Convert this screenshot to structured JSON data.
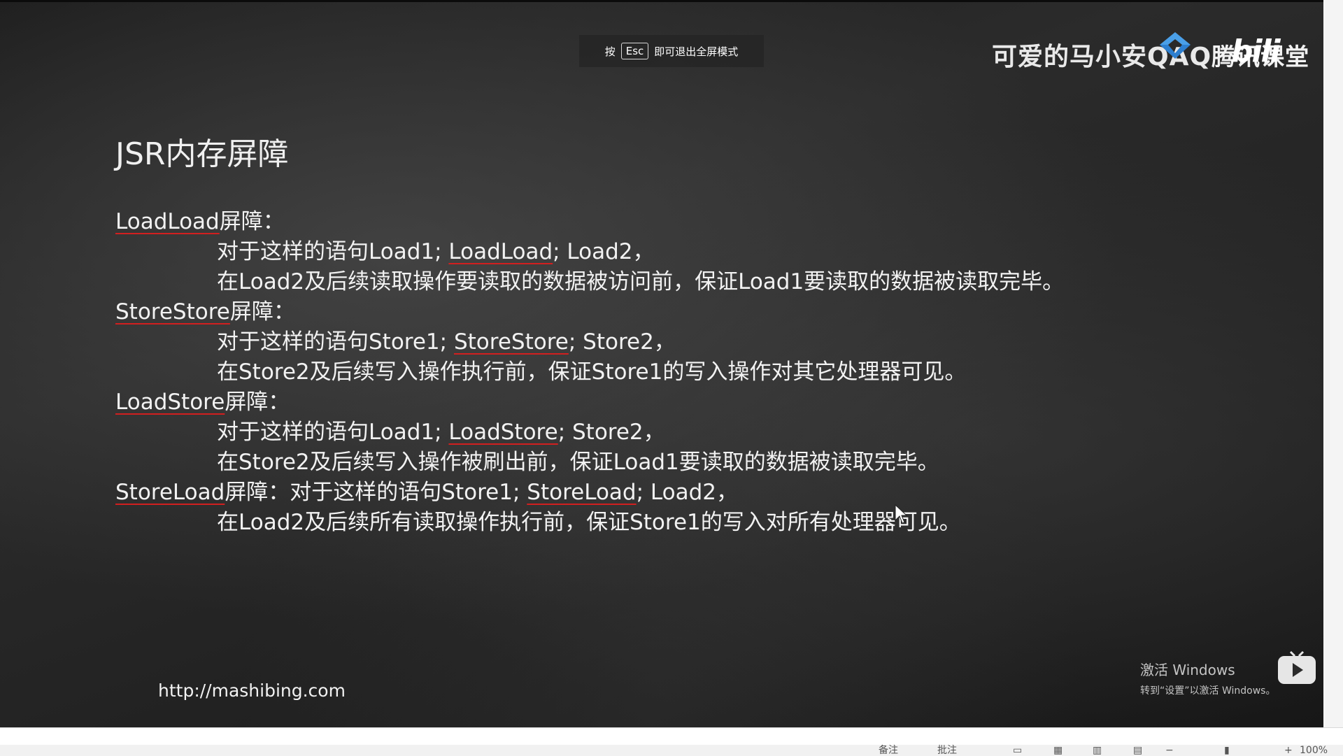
{
  "esc_hint": {
    "prefix": "按",
    "key": "Esc",
    "suffix": "即可退出全屏模式"
  },
  "watermark": {
    "text": "可爱的马小安QAQ",
    "ketang": "腾讯课堂",
    "bili": "bili"
  },
  "slide": {
    "title": "JSR内存屏障",
    "lines": [
      {
        "indent": false,
        "ul": "LoadLoad",
        "rest": "屏障："
      },
      {
        "indent": true,
        "pre": "对于这样的语句Load1; ",
        "ul": "LoadLoad",
        "rest": "; Load2，"
      },
      {
        "indent": true,
        "pre": "在Load2及后续读取操作要读取的数据被访问前，保证Load1要读取的数据被读取完毕。"
      },
      {
        "indent": false,
        "ul": "StoreStore",
        "rest": "屏障："
      },
      {
        "indent": true,
        "pre": "对于这样的语句Store1; ",
        "ul": "StoreStore",
        "rest": "; Store2，"
      },
      {
        "indent": true,
        "pre": "在Store2及后续写入操作执行前，保证Store1的写入操作对其它处理器可见。"
      },
      {
        "indent": false,
        "ul": "LoadStore",
        "rest": "屏障："
      },
      {
        "indent": true,
        "pre": "对于这样的语句Load1; ",
        "ul": "LoadStore",
        "rest": "; Store2，"
      },
      {
        "indent": true,
        "pre": "在Store2及后续写入操作被刷出前，保证Load1要读取的数据被读取完毕。"
      },
      {
        "indent": false,
        "ul": "StoreLoad",
        "rest": "屏障：对于这样的语句Store1; ",
        "ul2": "StoreLoad",
        "rest2": "; Load2，"
      },
      {
        "indent": true,
        "pre": "在Load2及后续所有读取操作执行前，保证Store1的写入对所有处理器可见。"
      }
    ],
    "url": "http://mashibing.com"
  },
  "windows_activation": {
    "line1": "激活 Windows",
    "line2": "转到“设置”以激活 Windows。"
  },
  "status_bar": {
    "notes": "备注",
    "comments": "批注",
    "zoom": "100%"
  },
  "colors": {
    "underline": "#d21f1f",
    "text": "#f2f2f2"
  }
}
